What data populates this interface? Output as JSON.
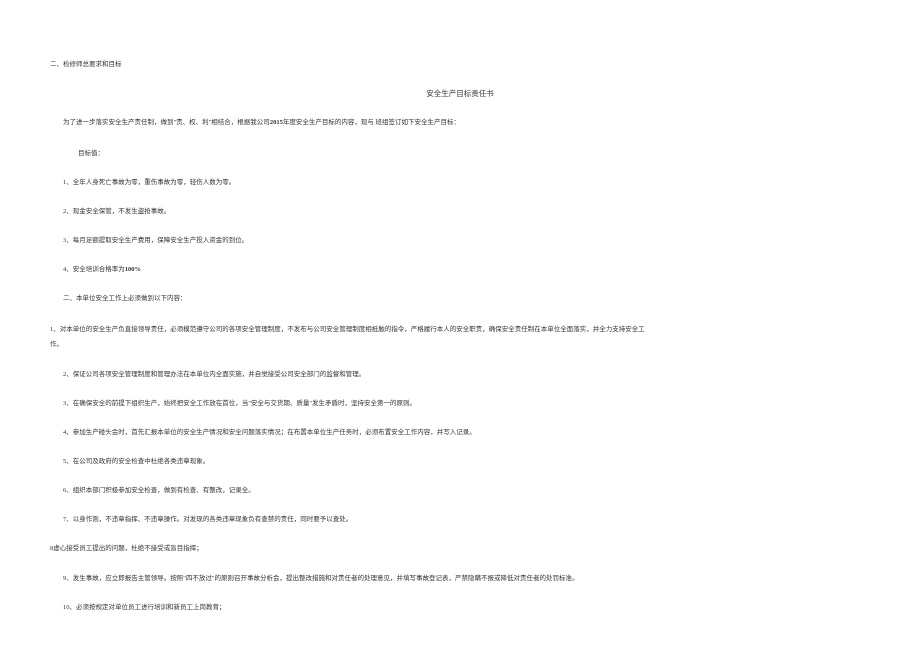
{
  "header": "二、检修师总要求和目标",
  "title": "安全生产目标责任书",
  "intro": {
    "prefix": "为了进一步落实安全生产责任制，做到\"责、权、利\"相结合，根据我公司",
    "bold1": "2015",
    "mid": "年度安全生产目标的内容，现与",
    "blank": "        ",
    "suffix": "班组签订如下安全生产目标："
  },
  "section1_label": "目标值：",
  "items1": [
    "1、全年人身死亡事故为零，重伤事故为零，轻伤人数为零。",
    "2、现金安全保管，不发生盗抢事故。",
    "3、每月足额提取安全生产费用，保障安全生产投入资金的到位。"
  ],
  "item4": {
    "prefix": "4、安全培训合格率为",
    "bold": "100%"
  },
  "subsection_label": "二、本单位安全工作上必须做到以下内容：",
  "long_item1": {
    "line1": "1、对本单位的安全生产负直接领导责任，必须模范遵守公司的各项安全管理制度，不发布与公司安全管理制度相抵触的指令，严格履行本人的安全职责，确保安全责任制在本单位全面落实，并全力支持安全工",
    "line2": "作。"
  },
  "items2": [
    "2、保证公司各项安全管理制度和管理办法在本单位内全面实施，并自觉接受公司安全部门的监督和管理。",
    "3、在确保安全的前提下组织生产，始终把安全工作放在首位，当\"安全与交货期、质量\"发生矛盾时，坚持安全第一的原则。",
    "4、参加生产碰头会时，首先汇报本单位的安全生产情况和安全问题落实情况；在布置本单位生产任务时，必须布置安全工作内容，并写入记录。",
    "5、在公司及政府的安全检查中杜绝各类违章现象。",
    "6、组织本部门积极参加安全检查，做到有检查、有整改，记录全。",
    "7、以身作则，不违章指挥、不违章操作。对发现的各类违章现象负有查禁的责任，同时要予以查处。"
  ],
  "item8": "8虚心接受员工提出的问题，杜绝不接受或盲目指挥；",
  "items3": [
    "9、发生事故，应立即报告主管领导。按照\"四不放过\"的原则召开事故分析会，提出整改措施和对责任者的处理意见，并填写事故登记表，严禁隐瞒不报或降低对责任者的处罚标准。",
    "10、必须按规定对单位员工进行培训和新员工上岗教育；"
  ]
}
